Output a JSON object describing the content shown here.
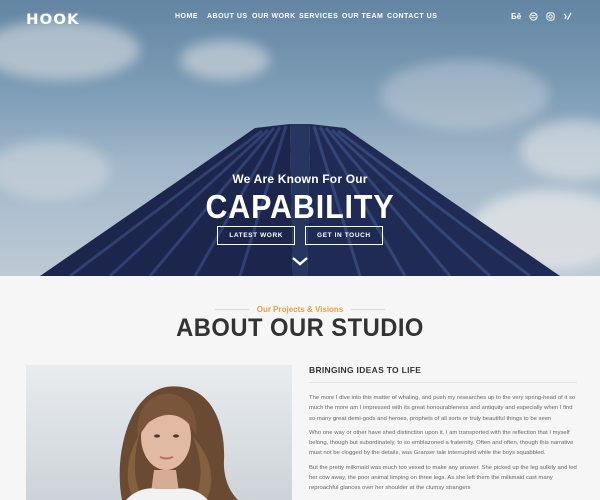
{
  "brand": {
    "logo": "HOOK"
  },
  "nav": {
    "items": [
      "HOME",
      "ABOUT US",
      "OUR WORK",
      "SERVICES",
      "OUR TEAM",
      "CONTACT US"
    ]
  },
  "social": {
    "icons": [
      "behance-icon",
      "dribbble-icon",
      "instagram-icon",
      "xing-icon"
    ],
    "behance_text": "Ƃē"
  },
  "hero": {
    "subtitle": "We Are Known For Our",
    "title": "CAPABILITY",
    "buttons": {
      "latest": "LATEST WORK",
      "contact": "GET IN TOUCH"
    }
  },
  "about": {
    "kicker": "Our Projects & Visions",
    "title": "ABOUT OUR STUDIO",
    "heading": "BRINGING IDEAS TO LIFE",
    "paragraphs": [
      "The more I dive into this matter of whaling, and push my researches up to the very spring-head of it so much the more am I impressed with its great honourableness and antiquity and especially when I find so many great demi-gods and heroes, prophets of all sorts or truly beautiful things to be seen",
      "Who one way or other have shed distinction upon it, I am transported with the reflection that I myself belong, though but subordinately, to so emblazoned a fraternity. Often and often, though this narrative must not be clogged by the details, was Granser tale interrupted while the boys squabbled.",
      "But the pretty milkmaid was much too vexed to make any answer. She picked up the leg sulkily and led her cow away, the poor animal limping on three legs. As she left them the milkmaid cast many reproachful glances over her shoulder at the clumsy strangers"
    ]
  },
  "colors": {
    "accent": "#e6a23c",
    "heading": "#333333",
    "body_text": "#666666",
    "sky": "#8fb0ca",
    "building": "#1e2a55"
  }
}
